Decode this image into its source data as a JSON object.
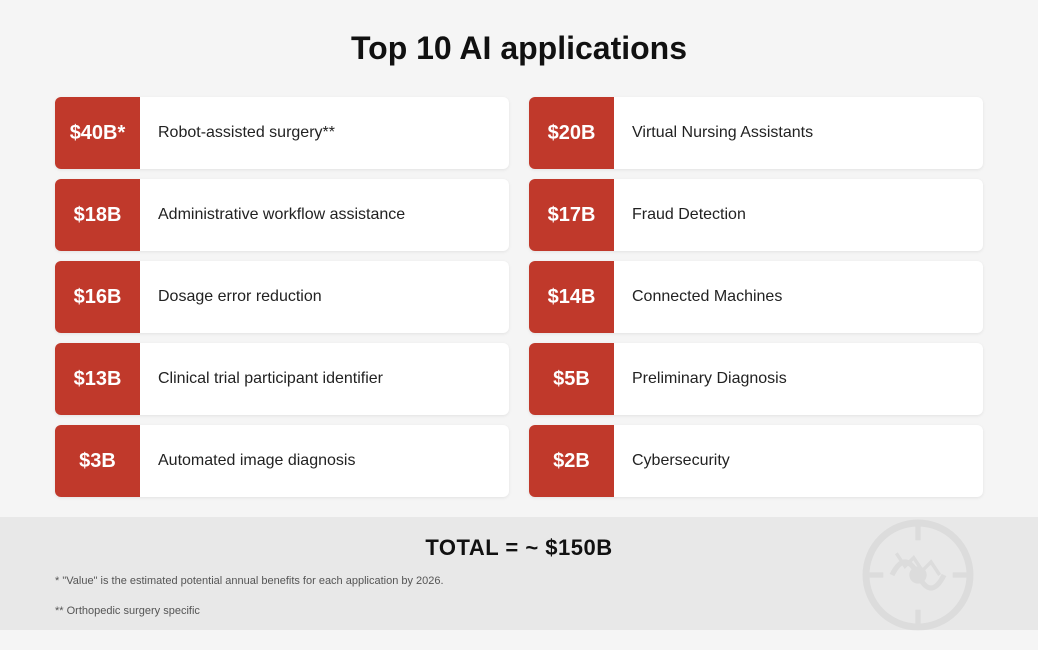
{
  "page": {
    "title": "Top 10 AI applications",
    "total_label": "TOTAL = ~ $150B",
    "footnotes": [
      "* \"Value\" is the estimated potential annual benefits for each application by 2026.",
      "** Orthopedic surgery specific"
    ],
    "left_column": [
      {
        "badge": "$40B*",
        "label": "Robot-assisted surgery**"
      },
      {
        "badge": "$18B",
        "label": "Administrative workflow assistance"
      },
      {
        "badge": "$16B",
        "label": "Dosage error reduction"
      },
      {
        "badge": "$13B",
        "label": "Clinical trial participant identifier"
      },
      {
        "badge": "$3B",
        "label": "Automated image diagnosis"
      }
    ],
    "right_column": [
      {
        "badge": "$20B",
        "label": "Virtual Nursing Assistants"
      },
      {
        "badge": "$17B",
        "label": "Fraud Detection"
      },
      {
        "badge": "$14B",
        "label": "Connected Machines"
      },
      {
        "badge": "$5B",
        "label": "Preliminary Diagnosis"
      },
      {
        "badge": "$2B",
        "label": "Cybersecurity"
      }
    ]
  }
}
